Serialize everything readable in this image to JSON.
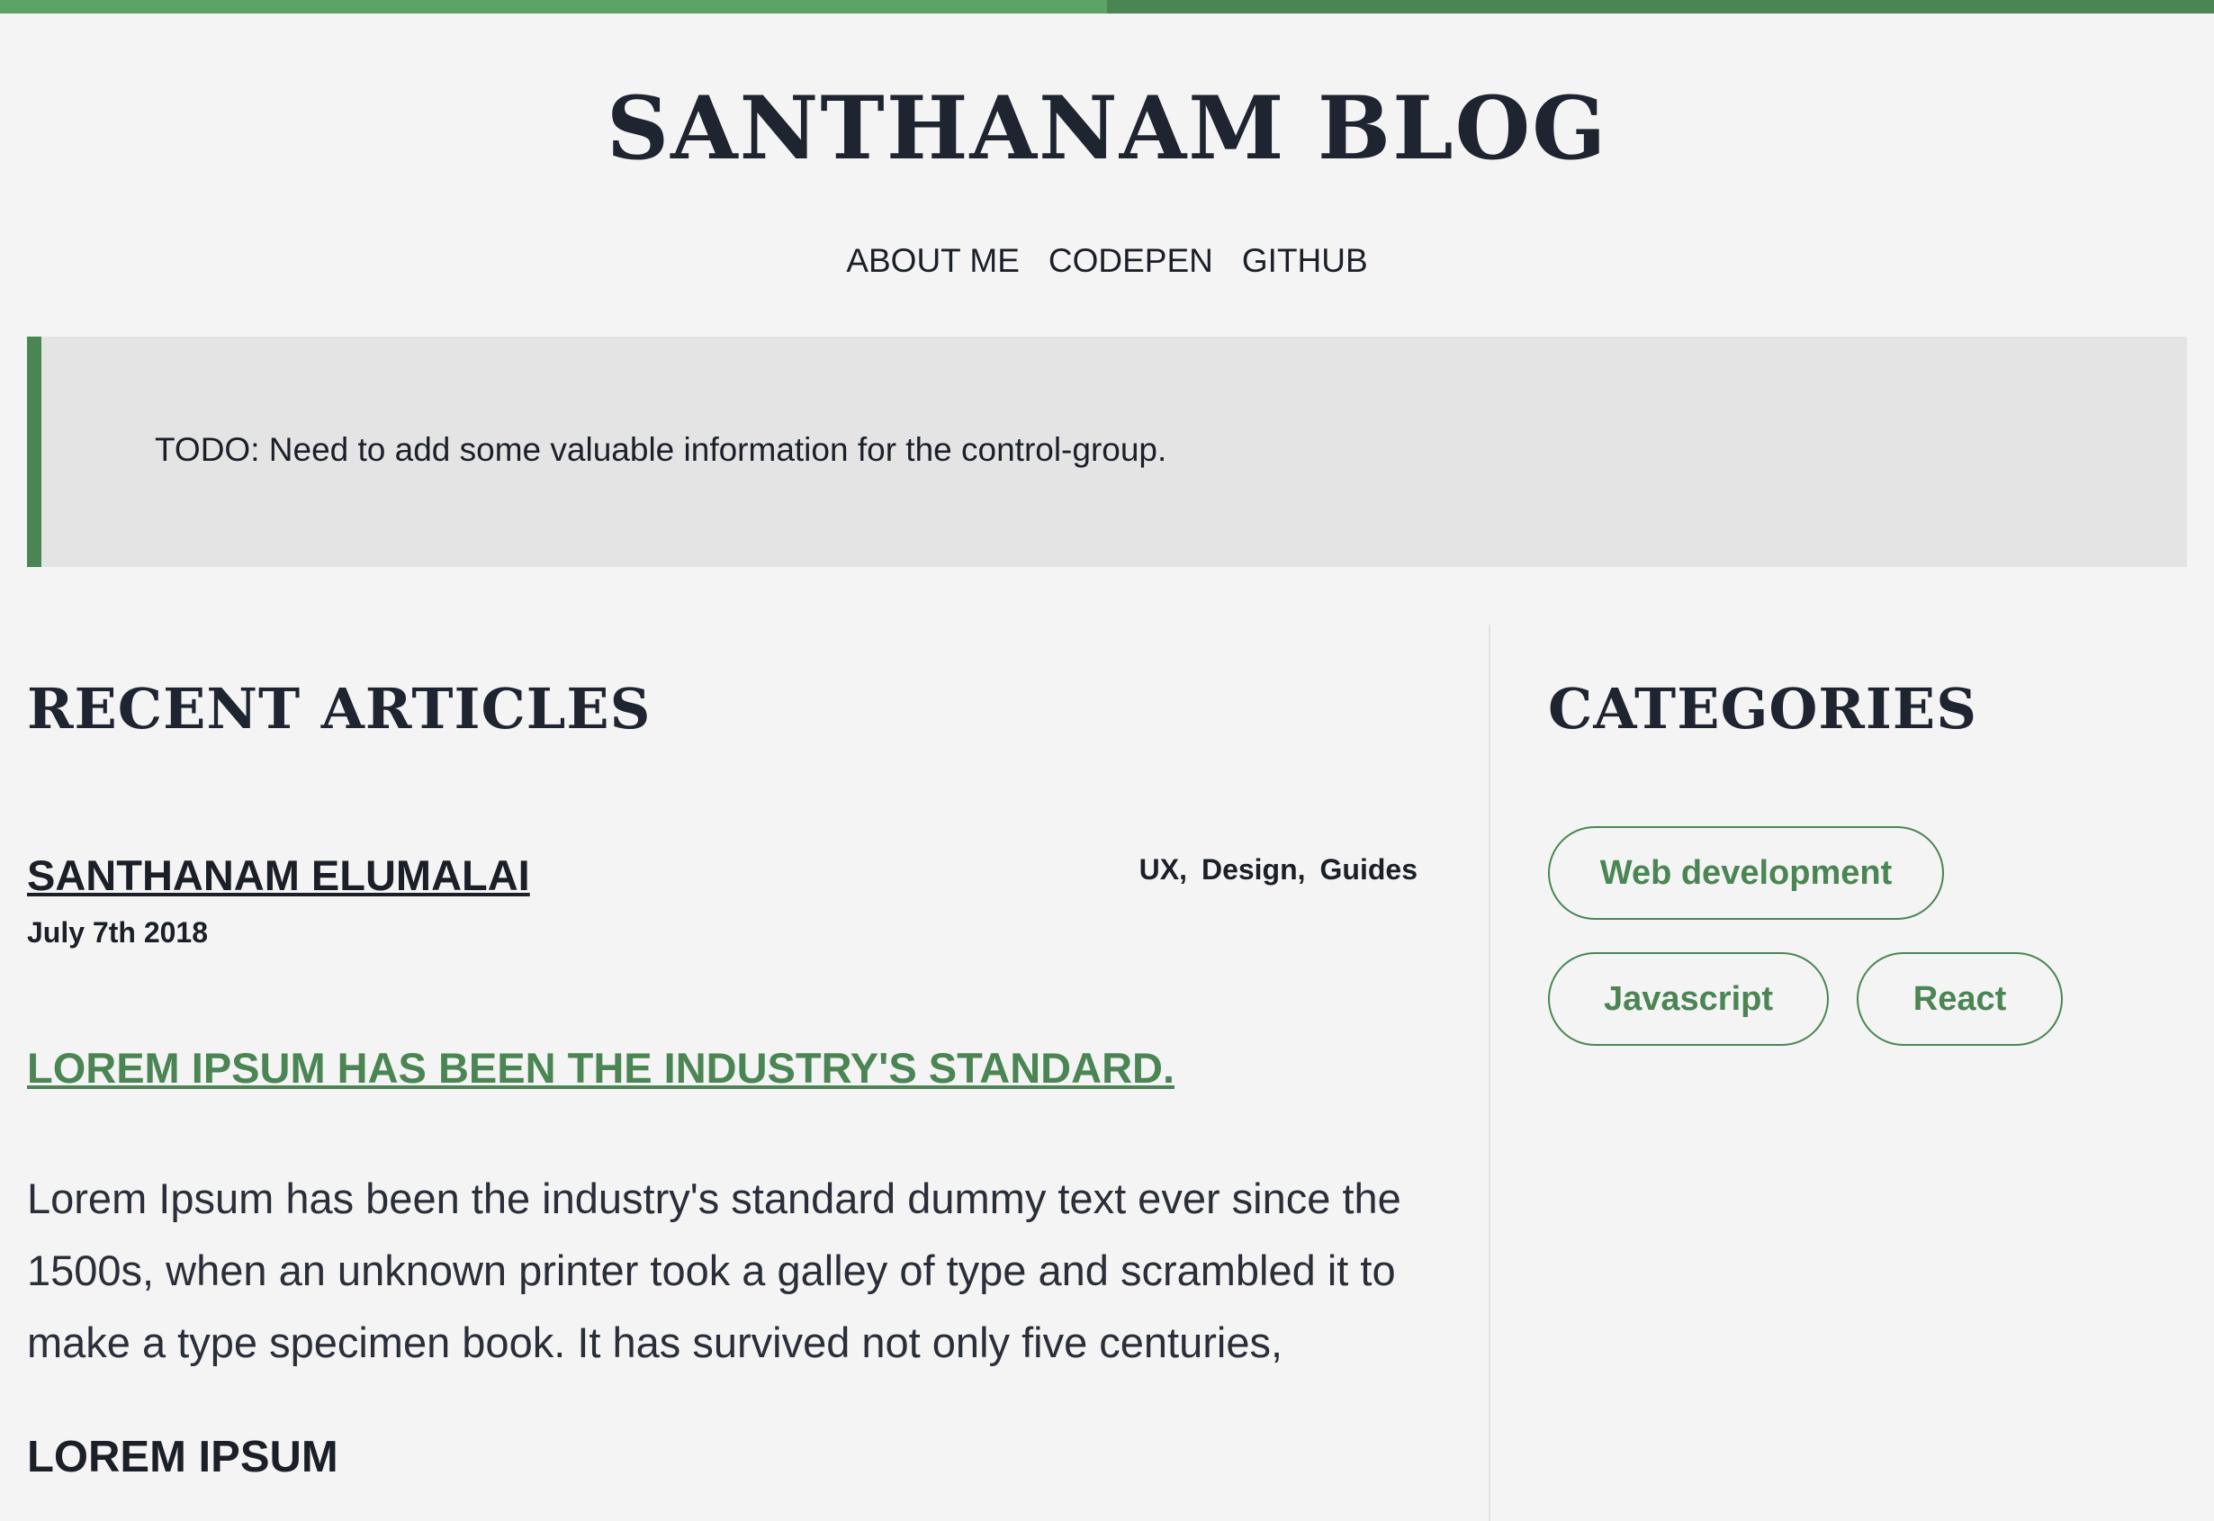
{
  "site": {
    "title": "SANTHANAM BLOG"
  },
  "nav": {
    "items": [
      {
        "label": "ABOUT ME"
      },
      {
        "label": "CODEPEN"
      },
      {
        "label": "GITHUB"
      }
    ]
  },
  "notice": {
    "text": "TODO: Need to add some valuable information for the control-group."
  },
  "recent": {
    "heading": "RECENT ARTICLES",
    "article": {
      "author": "SANTHANAM ELUMALAI",
      "date": "July 7th 2018",
      "tags": [
        "UX,",
        "Design,",
        "Guides"
      ],
      "title": "LOREM IPSUM HAS BEEN THE INDUSTRY'S STANDARD.",
      "body": "Lorem Ipsum has been the industry's standard dummy text ever since the 1500s, when an unknown printer took a galley of type and scrambled it to make a type specimen book. It has survived not only five centuries,",
      "subheading": "LOREM IPSUM"
    }
  },
  "categories": {
    "heading": "CATEGORIES",
    "items": [
      {
        "label": "Web development"
      },
      {
        "label": "Javascript"
      },
      {
        "label": "React"
      }
    ]
  },
  "colors": {
    "accent": "#4a8553",
    "accent_light": "#5ba367",
    "background": "#f4f4f4",
    "notice_background": "#e4e4e4",
    "text": "#1b1f28"
  }
}
